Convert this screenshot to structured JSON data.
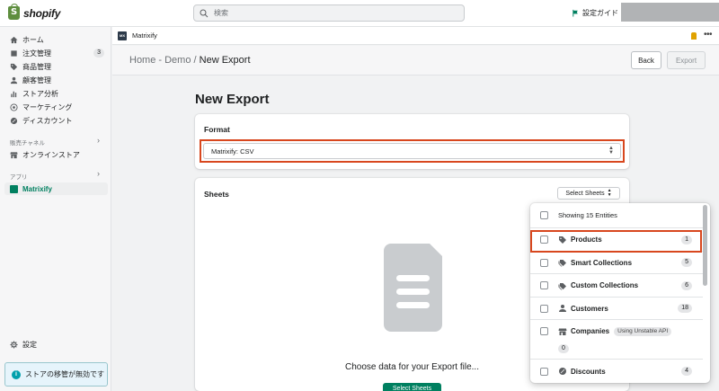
{
  "topbar": {
    "logo_text": "shopify",
    "search_placeholder": "検索",
    "setup_guide": "設定ガイド"
  },
  "sidebar": {
    "items": [
      {
        "label": "ホーム",
        "icon": "home-icon"
      },
      {
        "label": "注文管理",
        "icon": "orders-icon",
        "badge": "3"
      },
      {
        "label": "商品管理",
        "icon": "tag-icon"
      },
      {
        "label": "顧客管理",
        "icon": "person-icon"
      },
      {
        "label": "ストア分析",
        "icon": "analytics-icon"
      },
      {
        "label": "マーケティング",
        "icon": "target-icon"
      },
      {
        "label": "ディスカウント",
        "icon": "discount-icon"
      }
    ],
    "sales_channels_label": "販売チャネル",
    "online_store": "オンラインストア",
    "apps_label": "アプリ",
    "active_app": "Matrixify",
    "settings": "設定",
    "notice": "ストアの移管が無効です"
  },
  "appbar": {
    "app_name": "Matrixify",
    "logo_text": "MX"
  },
  "header": {
    "breadcrumb_parent": "Home - Demo",
    "breadcrumb_sep": " / ",
    "breadcrumb_current": "New Export",
    "back_label": "Back",
    "export_label": "Export"
  },
  "main": {
    "title": "New Export",
    "format_title": "Format",
    "format_value": "Matrixify: CSV",
    "sheets_title": "Sheets",
    "select_sheets_label": "Select Sheets",
    "choose_text": "Choose data for your Export file...",
    "select_sheets_button": "Select Sheets"
  },
  "popover": {
    "showing": "Showing 15 Entities",
    "items": [
      {
        "label": "Products",
        "count": "1",
        "icon": "tag-icon"
      },
      {
        "label": "Smart Collections",
        "count": "5",
        "icon": "collections-icon"
      },
      {
        "label": "Custom Collections",
        "count": "6",
        "icon": "collections-icon"
      },
      {
        "label": "Customers",
        "count": "18",
        "icon": "person-icon"
      },
      {
        "label": "Companies",
        "badge": "Using Unstable API",
        "count": "0",
        "icon": "store-icon"
      },
      {
        "label": "Discounts",
        "count": "4",
        "icon": "discount-icon"
      }
    ]
  },
  "colors": {
    "accent": "#008060",
    "highlight": "#d8471e",
    "info": "#00a0ac"
  }
}
